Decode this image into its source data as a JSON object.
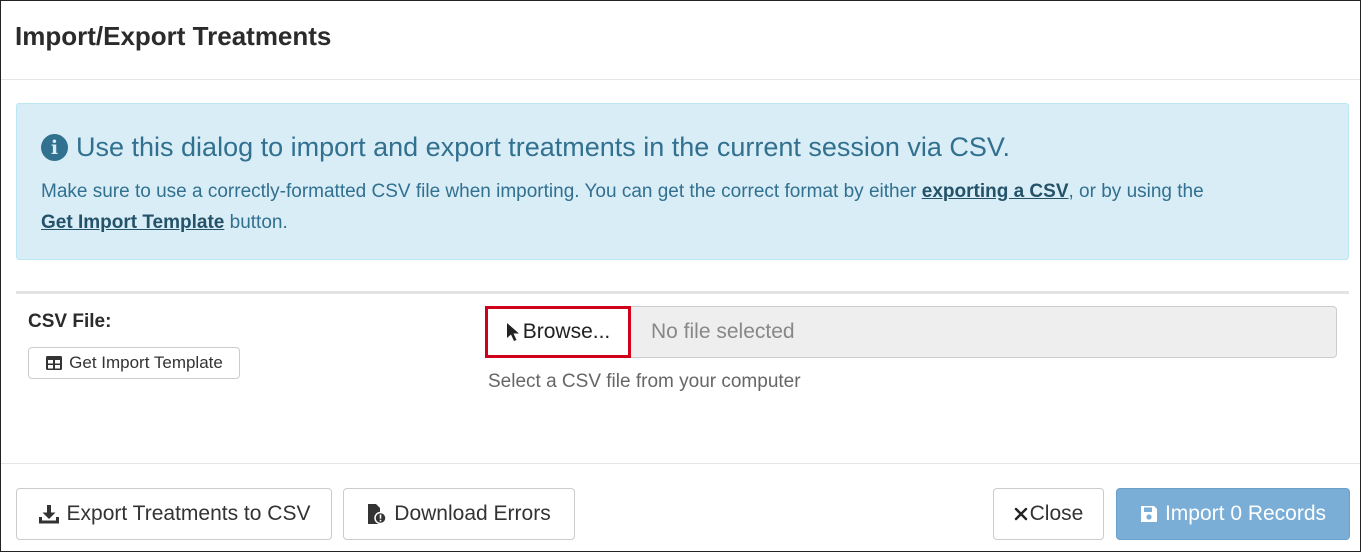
{
  "dialog": {
    "title": "Import/Export Treatments"
  },
  "info": {
    "icon": "info-circle-icon",
    "heading": "Use this dialog to import and export treatments in the current session via CSV.",
    "body_before": "Make sure to use a correctly-formatted CSV file when importing. You can get the correct format by either ",
    "link_export": "exporting a CSV",
    "body_middle": ", or by using the ",
    "link_template": "Get Import Template",
    "body_after": " button.",
    "colors": {
      "background": "#d9edf7",
      "text": "#31708f"
    }
  },
  "form": {
    "csv_label": "CSV File:",
    "template_button": "Get Import Template",
    "browse_button": "Browse...",
    "file_placeholder": "No file selected",
    "help_text": "Select a CSV file from your computer",
    "highlight_color": "#d0021b"
  },
  "footer": {
    "export_button": "Export Treatments to CSV",
    "errors_button": "Download Errors",
    "close_button": "Close",
    "import_button": "Import 0 Records",
    "import_color": "#7aaed6"
  }
}
